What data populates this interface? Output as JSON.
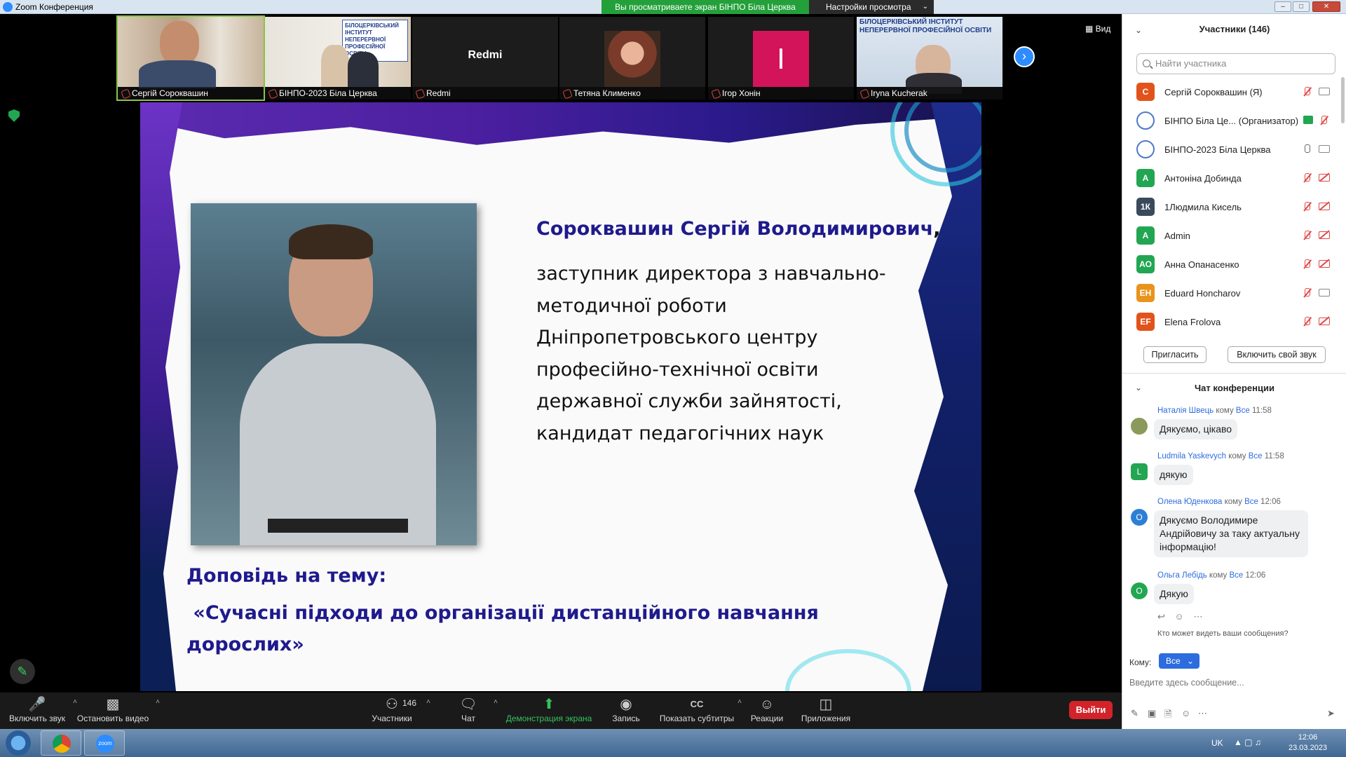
{
  "window": {
    "title": "Zoom Конференция",
    "share_banner": "Вы просматриваете экран БІНПО Біла Церква",
    "view_settings": "Настройки просмотра"
  },
  "thumbnails": {
    "view_label": "Вид",
    "items": [
      {
        "name": "Сергій Сороквашин"
      },
      {
        "name": "БІНПО-2023 Біла Церква"
      },
      {
        "name": "Redmi",
        "center": "Redmi"
      },
      {
        "name": "Тетяна Клименко"
      },
      {
        "name": "Ігор Хонін",
        "initial": "І"
      },
      {
        "name": "Iryna Kucherak"
      }
    ],
    "thumb2_banner": "БІЛОЦЕРКІВСЬКИЙ ІНСТИТУТ НЕПЕРЕРВНОЇ ПРОФЕСІЙНОЇ ОСВІТИ"
  },
  "slide": {
    "name": "Сороквашин Сергій Володимирович",
    "name_suffix": ",",
    "bio_lines": [
      "заступник директора з навчально-",
      "методичної роботи",
      "Дніпропетровського центру",
      "професійно-технічної освіти",
      "державної служби зайнятості,",
      "кандидат педагогічних наук"
    ],
    "topic_label": "Доповідь на тему:",
    "topic_line1": " «Сучасні підходи до організації дистанційного навчання",
    "topic_line2": "дорослих»"
  },
  "toolbar": {
    "unmute": "Включить звук",
    "stop_video": "Остановить видео",
    "participants": "Участники",
    "participants_count": "146",
    "chat": "Чат",
    "share": "Демонстрация экрана",
    "record": "Запись",
    "captions": "Показать субтитры",
    "reactions": "Реакции",
    "apps": "Приложения",
    "leave": "Выйти"
  },
  "participants": {
    "header": "Участники (146)",
    "search_placeholder": "Найти участника",
    "items": [
      {
        "initials": "С",
        "color": "#e2531c",
        "name": "Сергій Сороквашин (Я)"
      },
      {
        "initials": "",
        "color": "#ffffff",
        "name": "БІНПО Біла Це...  (Организатор)"
      },
      {
        "initials": "",
        "color": "#ffffff",
        "name": "БІНПО-2023 Біла Церква"
      },
      {
        "initials": "А",
        "color": "#22a652",
        "name": " Антоніна Добинда"
      },
      {
        "initials": "1К",
        "color": "#3a4a5c",
        "name": "1Людмила Кисель"
      },
      {
        "initials": "A",
        "color": "#22a652",
        "name": "Admin"
      },
      {
        "initials": "АО",
        "color": "#22a652",
        "name": "Анна Опанасенко"
      },
      {
        "initials": "EH",
        "color": "#e8941c",
        "name": "Eduard Honcharov"
      },
      {
        "initials": "EF",
        "color": "#e2531c",
        "name": "Elena Frolova"
      }
    ],
    "invite": "Пригласить",
    "unmute_self": "Включить свой звук"
  },
  "chat": {
    "header": "Чат конференции",
    "to_word": "кому",
    "messages": [
      {
        "sender": "Наталія Швець",
        "to": "Все",
        "time": "11:58",
        "text": "Дякуємо, цікаво",
        "initial": "",
        "color": "#8a9a5b"
      },
      {
        "sender": "Ludmila Yaskevych",
        "to": "Все",
        "time": "11:58",
        "text": "дякую",
        "initial": "L",
        "color": "#22a652"
      },
      {
        "sender": "Олена Юденкова",
        "to": "Все",
        "time": "12:06",
        "text": "Дякуємо Володимире Андрійовичу за таку актуальну інформацію!",
        "initial": "О",
        "color": "#2d7fd6"
      },
      {
        "sender": "Ольга Лебідь",
        "to": "Все",
        "time": "12:06",
        "text": "Дякую",
        "initial": "О",
        "color": "#22a652"
      }
    ],
    "who_sees": "Кто может видеть ваши сообщения?",
    "to_label": "Кому:",
    "to_value": "Все",
    "input_placeholder": "Введите здесь сообщение..."
  },
  "taskbar": {
    "lang": "UK",
    "time": "12:06",
    "date": "23.03.2023",
    "zoom_label": "zoom"
  }
}
